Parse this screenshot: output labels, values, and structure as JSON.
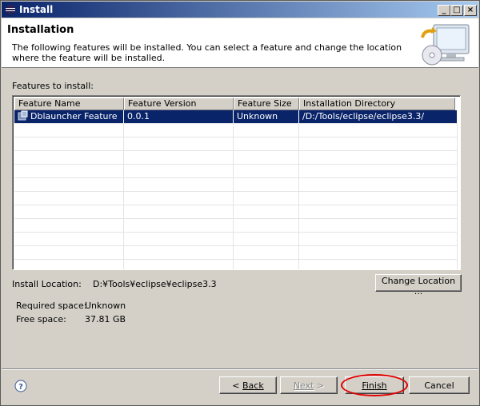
{
  "window": {
    "title": "Install"
  },
  "title_buttons": {
    "minimize": "_",
    "maximize": "□",
    "close": "×"
  },
  "banner": {
    "heading": "Installation",
    "description": "The following features will be installed. You can select a feature and change the location where the feature will be installed."
  },
  "features": {
    "label": "Features to install:",
    "columns": [
      "Feature Name",
      "Feature Version",
      "Feature Size",
      "Installation Directory"
    ],
    "rows": [
      {
        "name": "Dblauncher Feature",
        "version": "0.0.1",
        "size": "Unknown",
        "directory": "/D:/Tools/eclipse/eclipse3.3/",
        "selected": true
      }
    ]
  },
  "install_location": {
    "label": "Install Location:",
    "value": "D:¥Tools¥eclipse¥eclipse3.3",
    "change_button": "Change Location ..."
  },
  "space": {
    "required_label": "Required space:",
    "required_value": "Unknown",
    "free_label": "Free space:",
    "free_value": "37.81 GB"
  },
  "footer": {
    "back_arrow": "<",
    "back_label": "Back",
    "next_label": "Next",
    "next_arrow": ">",
    "finish_label": "Finish",
    "cancel_label": "Cancel"
  },
  "colors": {
    "selection": "#0a246a",
    "highlight_ring": "#e00000",
    "dialog_bg": "#d4d0c8"
  }
}
